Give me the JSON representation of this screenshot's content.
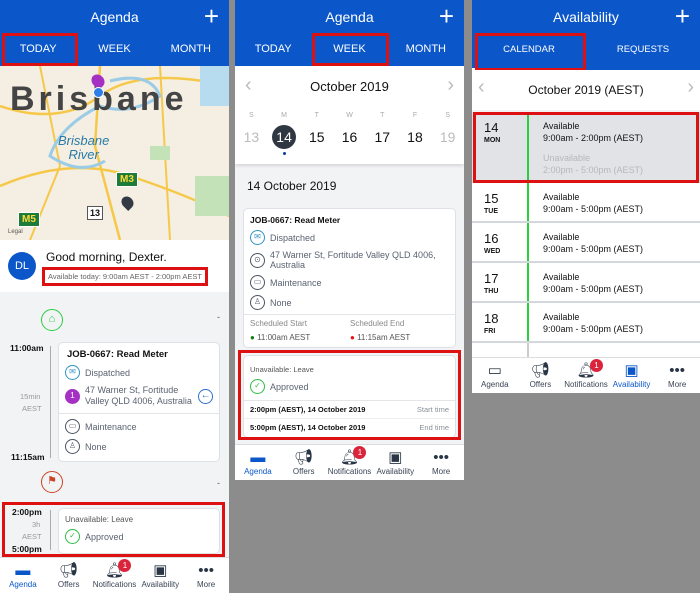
{
  "colors": {
    "brand": "#0b57c9",
    "highlight": "#d11111",
    "available": "#2ecc40",
    "badge": "#d9243b"
  },
  "nav": {
    "items": [
      {
        "label": "Agenda",
        "icon": "agenda-icon"
      },
      {
        "label": "Offers",
        "icon": "megaphone-icon"
      },
      {
        "label": "Notifications",
        "icon": "bell-icon",
        "badge": "1"
      },
      {
        "label": "Availability",
        "icon": "calendar-icon"
      },
      {
        "label": "More",
        "icon": "more-icon"
      }
    ]
  },
  "today": {
    "title": "Agenda",
    "tabs": [
      "TODAY",
      "WEEK",
      "MONTH"
    ],
    "map": {
      "city": "Brisbane",
      "river": "Brisbane\nRiver",
      "shields": [
        "M3",
        "M5",
        "13"
      ],
      "pin": "1",
      "legal": "Legal"
    },
    "avatar": "DL",
    "greeting": "Good morning, Dexter.",
    "availability": "Available today: 9:00am AEST - 2:00pm AEST",
    "job": {
      "start": "11:00am",
      "duration": "15min",
      "tz": "AEST",
      "end": "11:15am",
      "title": "JOB-0667: Read Meter",
      "status": "Dispatched",
      "pin": "1",
      "address": "47 Warner St, Fortitude Valley QLD 4006, Australia",
      "type": "Maintenance",
      "assignee": "None"
    },
    "leave": {
      "start": "2:00pm",
      "duration": "3h",
      "tz": "AEST",
      "end": "5:00pm",
      "title": "Unavailable: Leave",
      "status": "Approved"
    },
    "dash": "-"
  },
  "week": {
    "title": "Agenda",
    "tabs": [
      "TODAY",
      "WEEK",
      "MONTH"
    ],
    "month": "October 2019",
    "days": [
      {
        "d": "S",
        "n": "13"
      },
      {
        "d": "M",
        "n": "14"
      },
      {
        "d": "T",
        "n": "15"
      },
      {
        "d": "W",
        "n": "16"
      },
      {
        "d": "T",
        "n": "17"
      },
      {
        "d": "F",
        "n": "18"
      },
      {
        "d": "S",
        "n": "19"
      }
    ],
    "date_heading": "14 October 2019",
    "job": {
      "title": "JOB-0667: Read Meter",
      "status": "Dispatched",
      "address": "47 Warner St, Fortitude Valley QLD 4006, Australia",
      "type": "Maintenance",
      "assignee": "None",
      "start_label": "Scheduled Start",
      "start": "11:00am AEST",
      "end_label": "Scheduled End",
      "end": "11:15am AEST"
    },
    "leave": {
      "title": "Unavailable: Leave",
      "status": "Approved",
      "start": "2:00pm (AEST), 14 October 2019",
      "start_label": "Start time",
      "end": "5:00pm (AEST), 14 October 2019",
      "end_label": "End time"
    }
  },
  "availability": {
    "title": "Availability",
    "tabs": [
      "CALENDAR",
      "REQUESTS"
    ],
    "month": "October 2019 (AEST)",
    "rows": [
      {
        "day": "14",
        "dow": "MON",
        "l1": "Available",
        "t1": "9:00am - 2:00pm (AEST)",
        "l2": "Unavailable",
        "t2": "2:00pm - 5:00pm (AEST)"
      },
      {
        "day": "15",
        "dow": "TUE",
        "l1": "Available",
        "t1": "9:00am - 5:00pm (AEST)"
      },
      {
        "day": "16",
        "dow": "WED",
        "l1": "Available",
        "t1": "9:00am - 5:00pm (AEST)"
      },
      {
        "day": "17",
        "dow": "THU",
        "l1": "Available",
        "t1": "9:00am - 5:00pm (AEST)"
      },
      {
        "day": "18",
        "dow": "FRI",
        "l1": "Available",
        "t1": "9:00am - 5:00pm (AEST)"
      }
    ]
  }
}
